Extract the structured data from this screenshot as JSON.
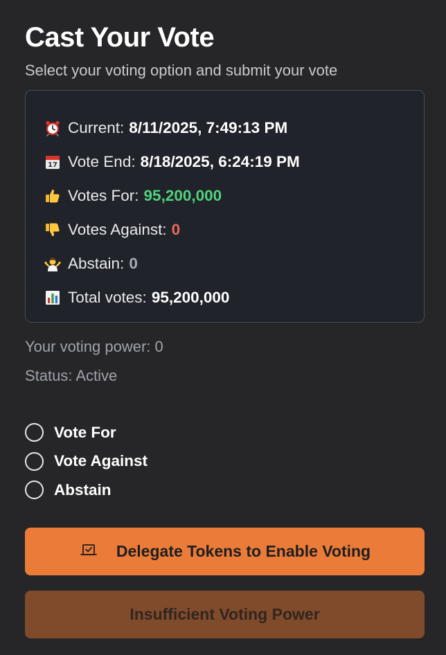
{
  "header": {
    "title": "Cast Your Vote",
    "subtitle": "Select your voting option and submit your vote"
  },
  "info": {
    "current": {
      "icon": "alarm-clock-icon",
      "label": "Current:",
      "value": "8/11/2025, 7:49:13 PM"
    },
    "vote_end": {
      "icon": "calendar-icon",
      "label": "Vote End:",
      "value": "8/18/2025, 6:24:19 PM"
    },
    "votes_for": {
      "icon": "thumbs-up-icon",
      "label": "Votes For:",
      "value": "95,200,000",
      "color": "#4fd27c"
    },
    "votes_against": {
      "icon": "thumbs-down-icon",
      "label": "Votes Against:",
      "value": "0",
      "color": "#f0675d"
    },
    "abstain": {
      "icon": "shrug-icon",
      "label": "Abstain:",
      "value": "0"
    },
    "total": {
      "icon": "bar-chart-icon",
      "label": "Total votes:",
      "value": "95,200,000"
    }
  },
  "status": {
    "voting_power": "Your voting power: 0",
    "status": "Status: Active"
  },
  "options": [
    {
      "label": "Vote For"
    },
    {
      "label": "Vote Against"
    },
    {
      "label": "Abstain"
    }
  ],
  "buttons": {
    "delegate": {
      "label": "Delegate Tokens to Enable Voting",
      "icon": "ballot-box-icon",
      "color": "#ea7b38"
    },
    "insufficient": {
      "label": "Insufficient Voting Power",
      "color": "#804b2b"
    }
  }
}
